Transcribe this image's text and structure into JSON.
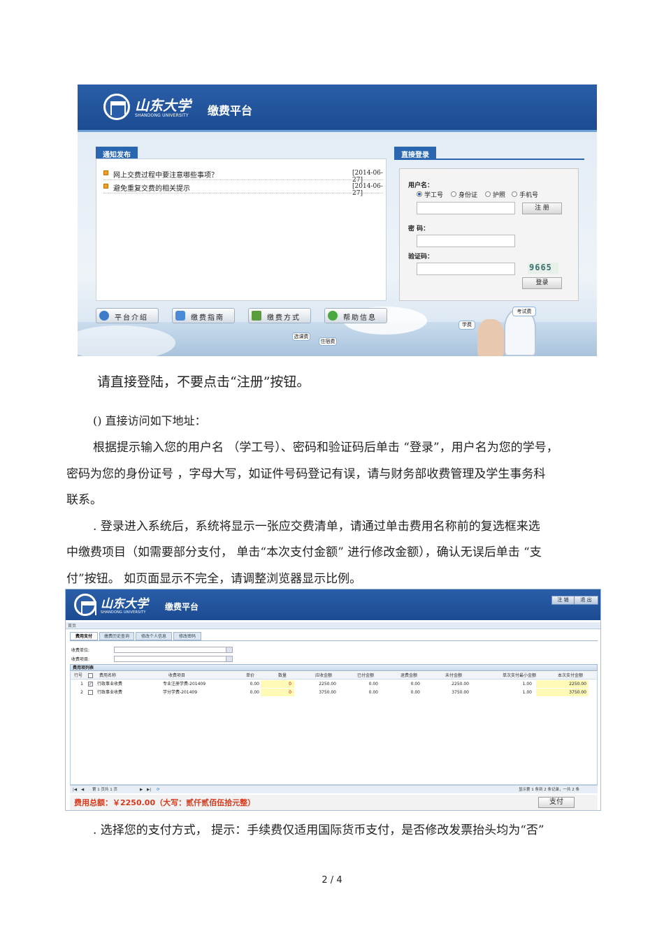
{
  "screenshot1": {
    "logo_cn": "山东大学",
    "logo_en": "SHANDONG UNIVERSITY",
    "platform_title": "缴费平台",
    "notice_tab": "通知发布",
    "notices": [
      {
        "title": "网上交费过程中要注意哪些事项？",
        "date": "[2014-06-27]"
      },
      {
        "title": "避免重复交费的相关提示",
        "date": "[2014-06-27]"
      }
    ],
    "login_tab": "直接登录",
    "username_label": "用户名：",
    "id_options": [
      "学工号",
      "身份证",
      "护照",
      "手机号"
    ],
    "register_button": "注 册",
    "password_label": "密 码：",
    "captcha_label": "验证码：",
    "captcha_value": "9665",
    "login_button": "登录",
    "nav_buttons": [
      "平台介绍",
      "缴费指南",
      "缴费方式",
      "帮助信息"
    ],
    "bubble_labels": [
      "选课费",
      "住宿费",
      "学费",
      "考试费"
    ]
  },
  "text": {
    "line1": "请直接登陆，不要点击“注册”按钮。",
    "line2": "() 直接访问如下地址：",
    "line3": "根据提示输入您的用户名 （学工号）、密码和验证码后单击 “登录”，用户名为您的学号，",
    "line4": "密码为您的身份证号 ，字母大写，如证件号码登记有误，请与财务部收费管理及学生事务科",
    "line5": "联系。",
    "line6": ". 登录进入系统后，系统将显示一张应交费清单，请通过单击费用名称前的复选框来选",
    "line7": "中缴费项目（如需要部分支付，  单击“本次支付金额” 进行修改金额），确认无误后单击 “支",
    "line8": "付”按钮。  如页面显示不完全，请调整浏览器显示比例。",
    "line9": ". 选择您的支付方式，  提示：手续费仅适用国际货币支付，是否修改发票抬头均为“否”"
  },
  "screenshot2": {
    "logo_cn": "山东大学",
    "logo_en": "SHANDONG UNIVERSITY",
    "platform_title": "缴费平台",
    "header_buttons": [
      "注 销",
      "退 出"
    ],
    "breadcrumb": "首页",
    "tabs": [
      "费用支付",
      "缴费历史查询",
      "修改个人信息",
      "修改密码"
    ],
    "filter_unit_label": "收费单位:",
    "filter_item_label": "收费项目:",
    "section_title": "费用项列表",
    "columns": [
      "行号",
      "费用名称",
      "收费项目",
      "单价",
      "数量",
      "应收金额",
      "已付金额",
      "退费金额",
      "未付金额",
      "单次支付最小金额",
      "本次支付金额"
    ],
    "rows": [
      {
        "no": "1",
        "checked": "✓",
        "name": "行政事业收费",
        "item": "专业注册学费-201409",
        "price": "0.00",
        "qty": "0",
        "due": "2250.00",
        "paid": "0.00",
        "refund": "0.00",
        "unpaid": "2250.00",
        "min": "1.00",
        "pay": "2250.00"
      },
      {
        "no": "2",
        "checked": "",
        "name": "行政事业收费",
        "item": "学分学费-201409",
        "price": "0.00",
        "qty": "0",
        "due": "3750.00",
        "paid": "0.00",
        "refund": "0.00",
        "unpaid": "3750.00",
        "min": "1.00",
        "pay": "3750.00"
      }
    ],
    "pager_left": "第  1  页共 1 页",
    "pager_right": "显示第 1 条到 2 条记录，一共 2 条",
    "total_text": "费用总额：￥2250.00（大写：贰仟贰佰伍拾元整）",
    "pay_button": "支付"
  },
  "page_number": "2 / 4",
  "colors": {
    "header_blue": "#1f52a0",
    "accent_red": "#d63a1c",
    "highlight_yellow": "#fffbb6"
  }
}
